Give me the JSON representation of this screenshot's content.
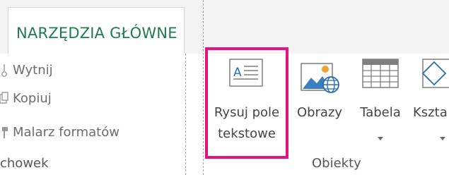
{
  "ribbon": {
    "active_tab": "NARZĘDZIA GŁÓWNE",
    "clipboard": {
      "items": [
        "Wytnij",
        "Kopiuj",
        "Malarz formatów"
      ],
      "group_label": "chowek"
    },
    "objects": {
      "buttons": [
        {
          "label_line1": "Rysuj pole",
          "label_line2": "tekstowe",
          "icon": "text-box-icon",
          "highlighted": true
        },
        {
          "label_line1": "Obrazy",
          "icon": "pictures-icon"
        },
        {
          "label_line1": "Tabela",
          "icon": "table-icon",
          "has_dropdown": true
        },
        {
          "label_line1": "Kszta",
          "icon": "shapes-icon",
          "has_dropdown": true
        }
      ],
      "group_label": "Obiekty"
    },
    "colors": {
      "tab_text": "#1f7a4f",
      "highlight": "#e5147d",
      "icon_blue": "#2b6cb0"
    }
  }
}
